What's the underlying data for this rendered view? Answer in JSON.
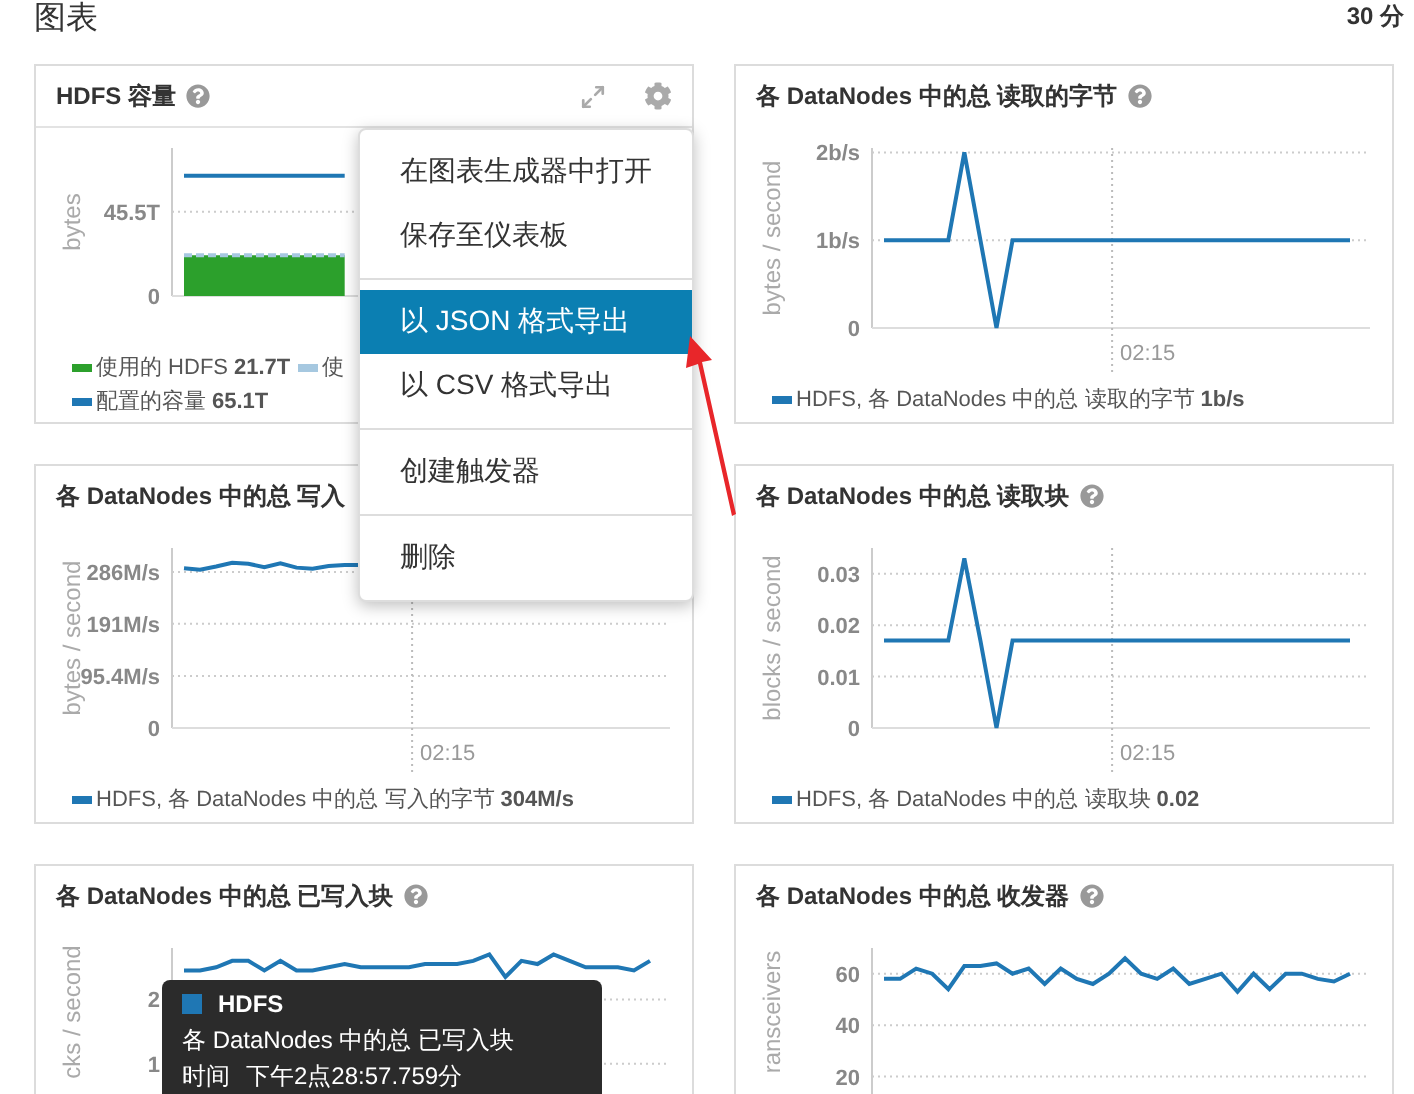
{
  "page": {
    "title": "图表",
    "range": "30 分"
  },
  "cards": [
    {
      "title": "HDFS 容量",
      "help": true,
      "legend_values": {
        "0": "21.7T",
        "2": "65.1T"
      },
      "chart_data": {
        "type": "area",
        "ylabel": "bytes",
        "ylim": [
          0,
          80
        ],
        "yticks": [
          {
            "value": 0,
            "label": "0"
          },
          {
            "value": 45.5,
            "label": "45.5T"
          }
        ],
        "grid": true,
        "series": [
          {
            "name": "使用的 HDFS",
            "color": "#2ca02c",
            "values": [
              22,
              22,
              22,
              22,
              22,
              22,
              22,
              22,
              22,
              22,
              22,
              null,
              null,
              null,
              null,
              null,
              null,
              null,
              null,
              null,
              null,
              null,
              null,
              null,
              null,
              null,
              null,
              null,
              null,
              null
            ]
          },
          {
            "name": "使",
            "type": "line",
            "line_style": "dashed",
            "color": "#a6c8e0",
            "values": [
              22,
              22,
              22,
              22,
              22,
              22,
              22,
              22,
              22,
              22,
              22,
              null,
              null,
              null,
              null,
              null,
              null,
              null,
              null,
              null,
              null,
              null,
              null,
              null,
              null,
              null,
              null,
              null,
              null,
              null
            ]
          },
          {
            "name": "配置的容量",
            "type": "line",
            "line_style": "solid",
            "color": "#1f77b4",
            "values": [
              65,
              65,
              65,
              65,
              65,
              65,
              65,
              65,
              65,
              65,
              65,
              null,
              null,
              null,
              null,
              null,
              null,
              null,
              null,
              null,
              null,
              null,
              null,
              null,
              null,
              null,
              null,
              null,
              null,
              null
            ]
          }
        ]
      },
      "menu": {
        "groups": [
          [
            {
              "label": "在图表生成器中打开",
              "selected": false
            },
            {
              "label": "保存至仪表板",
              "selected": false
            }
          ],
          [
            {
              "label": "以 JSON 格式导出",
              "selected": true
            },
            {
              "label": "以 CSV 格式导出",
              "selected": false
            }
          ],
          [
            {
              "label": "创建触发器",
              "selected": false
            }
          ],
          [
            {
              "label": "删除",
              "selected": false
            }
          ]
        ]
      }
    },
    {
      "title": "各 DataNodes 中的总 读取的字节",
      "help": true,
      "legend_values": {
        "0": "1b/s"
      },
      "chart_data": {
        "type": "line",
        "ylabel": "bytes / second",
        "ylim": [
          0,
          2.05
        ],
        "grid": true,
        "yticks": [
          {
            "value": 0,
            "label": "0"
          },
          {
            "value": 1,
            "label": "1b/s"
          },
          {
            "value": 2,
            "label": "2b/s"
          }
        ],
        "annotations": [
          "02:15"
        ],
        "series": [
          {
            "name": "HDFS, 各 DataNodes 中的总 读取的字节",
            "color": "#1f77b4",
            "values": [
              1,
              1,
              1,
              1,
              1,
              2,
              1,
              0,
              1,
              1,
              1,
              1,
              1,
              1,
              1,
              1,
              1,
              1,
              1,
              1,
              1,
              1,
              1,
              1,
              1,
              1,
              1,
              1,
              1,
              1
            ]
          }
        ]
      }
    },
    {
      "title": "各 DataNodes 中的总 写入",
      "help": false,
      "legend_values": {
        "0": "304M/s"
      },
      "chart_data": {
        "type": "line",
        "ylabel": "bytes / second",
        "ylim": [
          0,
          330
        ],
        "grid": true,
        "yticks": [
          {
            "value": 0,
            "label": "0"
          },
          {
            "value": 95.4,
            "label": "95.4M/s"
          },
          {
            "value": 191,
            "label": "191M/s"
          },
          {
            "value": 286,
            "label": "286M/s"
          }
        ],
        "annotations": [
          "02:15"
        ],
        "series": [
          {
            "name": "HDFS, 各 DataNodes 中的总 写入的字节",
            "color": "#1f77b4",
            "values": [
              293,
              290,
              296,
              303,
              301,
              295,
              302,
              294,
              292,
              297,
              299,
              299,
              null,
              null,
              null,
              null,
              null,
              null,
              null,
              null,
              null,
              null,
              null,
              null,
              null,
              null,
              null,
              null,
              null,
              null
            ]
          }
        ]
      }
    },
    {
      "title": "各 DataNodes 中的总 读取块",
      "help": true,
      "legend_values": {
        "0": "0.02"
      },
      "chart_data": {
        "type": "line",
        "ylabel": "blocks / second",
        "ylim": [
          0,
          0.035
        ],
        "grid": true,
        "yticks": [
          {
            "value": 0,
            "label": "0"
          },
          {
            "value": 0.01,
            "label": "0.01"
          },
          {
            "value": 0.02,
            "label": "0.02"
          },
          {
            "value": 0.03,
            "label": "0.03"
          }
        ],
        "annotations": [
          "02:15"
        ],
        "series": [
          {
            "name": "HDFS, 各 DataNodes 中的总 读取块",
            "color": "#1f77b4",
            "values": [
              0.017,
              0.017,
              0.017,
              0.017,
              0.017,
              0.033,
              0.017,
              0,
              0.017,
              0.017,
              0.017,
              0.017,
              0.017,
              0.017,
              0.017,
              0.017,
              0.017,
              0.017,
              0.017,
              0.017,
              0.017,
              0.017,
              0.017,
              0.017,
              0.017,
              0.017,
              0.017,
              0.017,
              0.017,
              0.017
            ]
          }
        ]
      }
    },
    {
      "title": "各 DataNodes 中的总 已写入块",
      "help": true,
      "chart_data": {
        "type": "line",
        "ylabel": "cks / second",
        "ylim": [
          0,
          2.8
        ],
        "grid": true,
        "yticks": [
          1,
          2
        ],
        "series": [
          {
            "name": "HDFS",
            "color": "#1f77b4",
            "values": [
              2.45,
              2.45,
              2.5,
              2.6,
              2.6,
              2.45,
              2.6,
              2.45,
              2.45,
              2.5,
              2.55,
              2.5,
              2.5,
              2.5,
              2.5,
              2.55,
              2.55,
              2.55,
              2.6,
              2.7,
              2.35,
              2.6,
              2.55,
              2.7,
              2.6,
              2.5,
              2.5,
              2.5,
              2.45,
              2.6
            ]
          }
        ]
      },
      "tooltip": {
        "metric": "各 DataNodes 中的总 已写入块",
        "time_label": "时间",
        "time": "下午2点28:57.759分"
      }
    },
    {
      "title": "各 DataNodes 中的总 收发器",
      "help": true,
      "chart_data": {
        "type": "line",
        "ylabel": "ransceivers",
        "ylim": [
          0,
          70
        ],
        "grid": true,
        "yticks": [
          20,
          40,
          60
        ],
        "series": [
          {
            "color": "#1f77b4",
            "values": [
              58,
              58,
              62,
              60,
              54,
              63,
              63,
              64,
              60,
              62,
              56,
              62,
              58,
              56,
              60,
              66,
              60,
              58,
              62,
              56,
              58,
              60,
              53,
              60,
              54,
              60,
              60,
              58,
              57,
              60
            ]
          }
        ]
      }
    }
  ]
}
